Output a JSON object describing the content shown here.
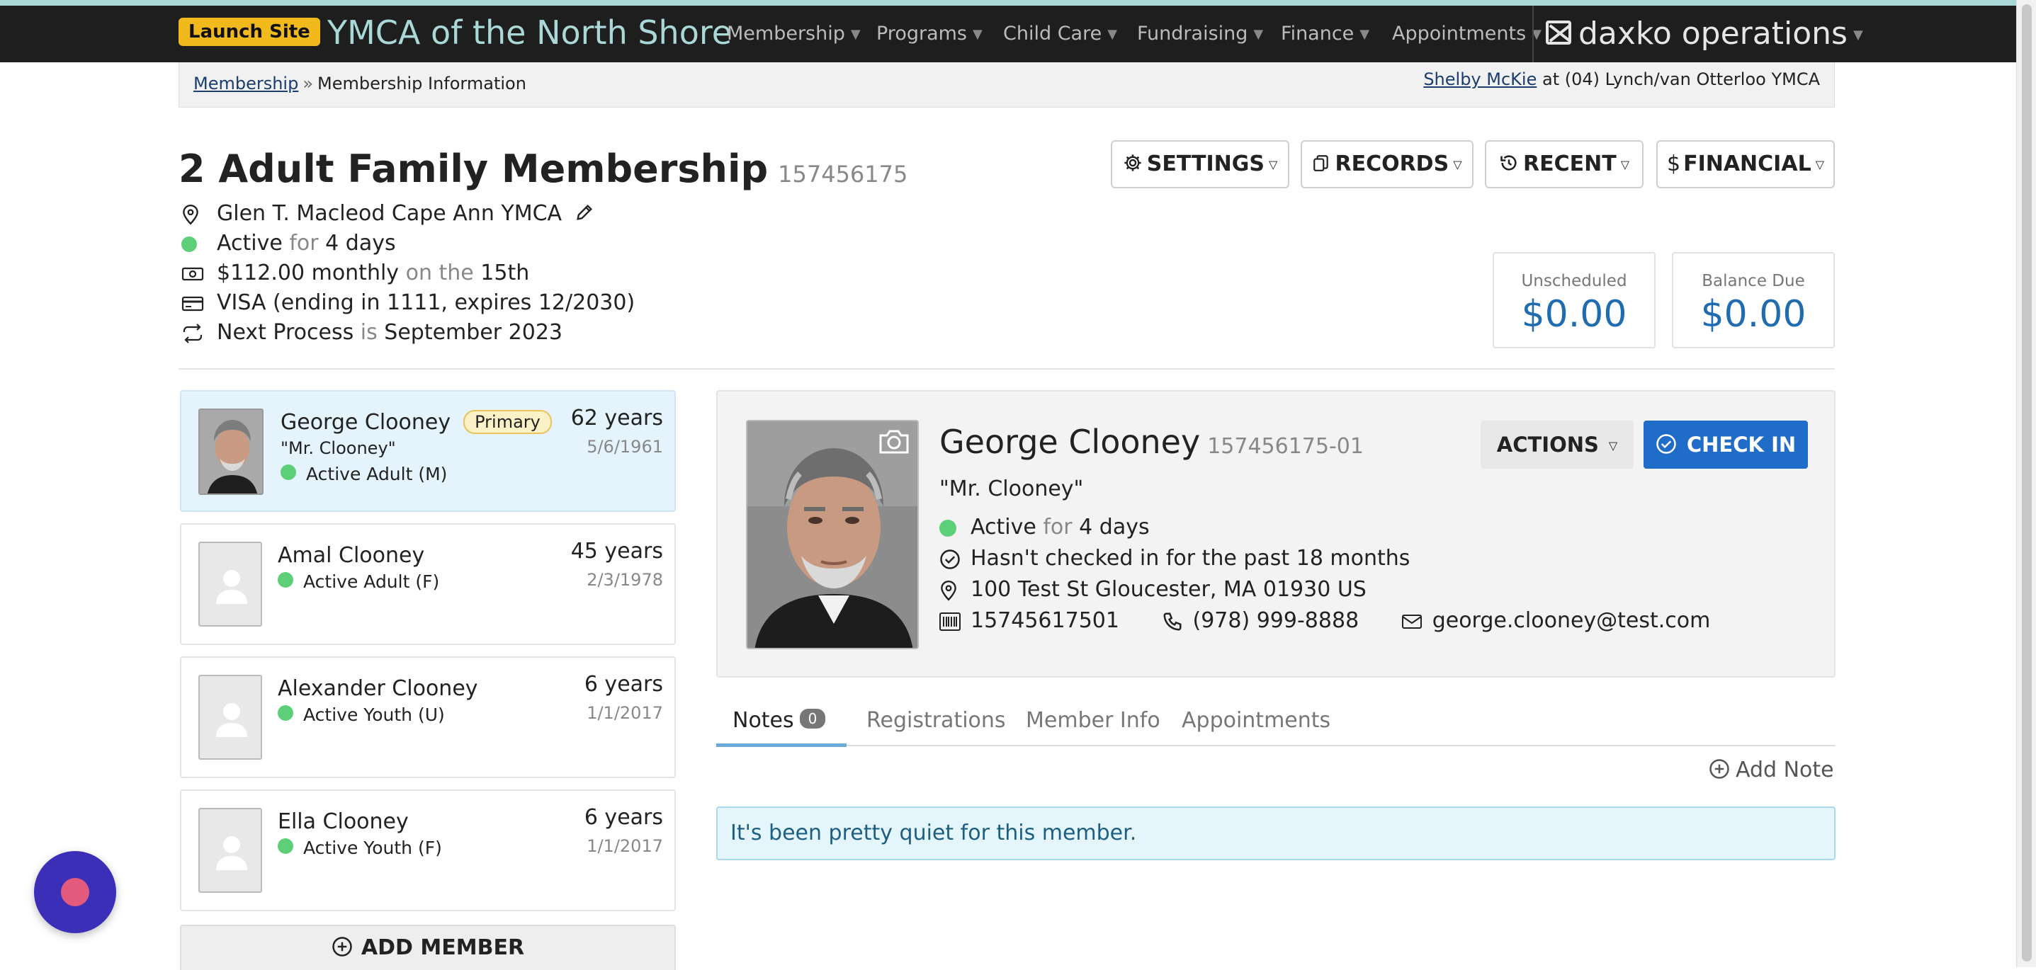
{
  "nav": {
    "launch_label": "Launch Site",
    "site_name": "YMCA of the North Shore",
    "items": [
      "Membership",
      "Programs",
      "Child Care",
      "Fundraising",
      "Finance",
      "Appointments"
    ],
    "brand": "daxko operations"
  },
  "breadcrumb": {
    "root": "Membership",
    "separator": "»",
    "current": "Membership Information"
  },
  "user": {
    "name": "Shelby McKie",
    "location": "at (04) Lynch/van Otterloo YMCA"
  },
  "membership": {
    "title": "2 Adult Family Membership",
    "id": "157456175",
    "branch": "Glen T. Macleod Cape Ann YMCA",
    "status": "Active",
    "status_for": "for",
    "status_duration": "4 days",
    "amount": "$112.00 monthly",
    "on_the": "on the",
    "day": "15th",
    "card": "VISA (ending in 1111, expires 12/2030)",
    "next_label": "Next Process",
    "next_is": "is",
    "next_date": "September 2023"
  },
  "buttons": {
    "settings": "SETTINGS",
    "records": "RECORDS",
    "recent": "RECENT",
    "financial": "FINANCIAL",
    "actions": "ACTIONS",
    "checkin": "CHECK IN",
    "add_member": "ADD MEMBER",
    "add_note": "Add Note"
  },
  "balances": [
    {
      "label": "Unscheduled",
      "amount": "$0.00"
    },
    {
      "label": "Balance Due",
      "amount": "$0.00"
    }
  ],
  "members": [
    {
      "name": "George Clooney",
      "badge": "Primary",
      "nickname": "\"Mr. Clooney\"",
      "status": "Active Adult (M)",
      "age": "62 years",
      "dob": "5/6/1961"
    },
    {
      "name": "Amal Clooney",
      "status": "Active Adult (F)",
      "age": "45 years",
      "dob": "2/3/1978"
    },
    {
      "name": "Alexander Clooney",
      "status": "Active Youth (U)",
      "age": "6 years",
      "dob": "1/1/2017"
    },
    {
      "name": "Ella Clooney",
      "status": "Active Youth (F)",
      "age": "6 years",
      "dob": "1/1/2017"
    }
  ],
  "detail": {
    "name": "George Clooney",
    "id": "157456175-01",
    "nickname": "\"Mr. Clooney\"",
    "status": "Active",
    "status_for": "for",
    "status_duration": "4 days",
    "checkin_note": "Hasn't checked in for the past 18 months",
    "address": "100 Test St Gloucester, MA 01930 US",
    "barcode": "15745617501",
    "phone": "(978) 999-8888",
    "email": "george.clooney@test.com"
  },
  "tabs": [
    {
      "label": "Notes",
      "count": "0"
    },
    {
      "label": "Registrations"
    },
    {
      "label": "Member Info"
    },
    {
      "label": "Appointments"
    }
  ],
  "notes_empty": "It's been pretty quiet for this member.",
  "colors": {
    "accent": "#1f6cc9",
    "balance": "#1f6cb1",
    "active": "#5ccf78",
    "launch": "#f1b91c",
    "site_name": "#a9d8d6"
  }
}
